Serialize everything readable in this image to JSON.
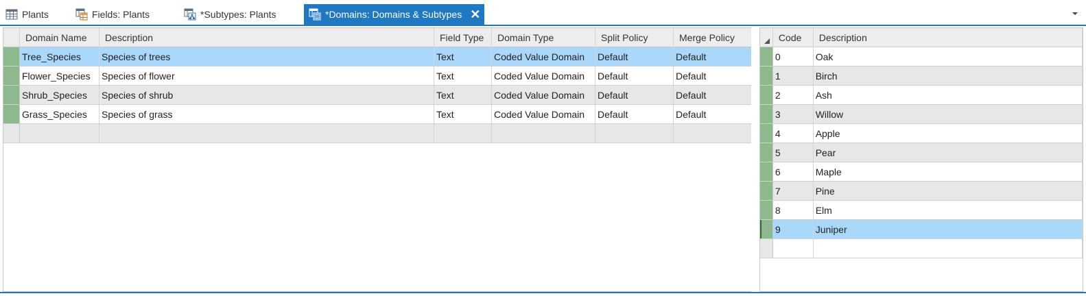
{
  "tabs": [
    {
      "label": "Plants",
      "icon": "table-icon",
      "active": false
    },
    {
      "label": "Fields:  Plants",
      "icon": "fields-view-icon",
      "active": false
    },
    {
      "label": "*Subtypes:  Plants",
      "icon": "subtypes-view-icon",
      "active": false
    },
    {
      "label": "*Domains: Domains & Subtypes",
      "icon": "domains-view-icon",
      "active": true
    }
  ],
  "colors": {
    "accent": "#1e78c2",
    "selected_row": "#a9d8fa",
    "alt_row": "#e6e7e8",
    "row_selector": "#8cba8c"
  },
  "domains_grid": {
    "headers": {
      "name": "Domain Name",
      "description": "Description",
      "field_type": "Field Type",
      "domain_type": "Domain Type",
      "split_policy": "Split Policy",
      "merge_policy": "Merge Policy"
    },
    "rows": [
      {
        "name": "Tree_Species",
        "description": "Species of trees",
        "field_type": "Text",
        "domain_type": "Coded Value Domain",
        "split_policy": "Default",
        "merge_policy": "Default"
      },
      {
        "name": "Flower_Species",
        "description": "Species of flower",
        "field_type": "Text",
        "domain_type": "Coded Value Domain",
        "split_policy": "Default",
        "merge_policy": "Default"
      },
      {
        "name": "Shrub_Species",
        "description": "Species of shrub",
        "field_type": "Text",
        "domain_type": "Coded Value Domain",
        "split_policy": "Default",
        "merge_policy": "Default"
      },
      {
        "name": "Grass_Species",
        "description": "Species of grass",
        "field_type": "Text",
        "domain_type": "Coded Value Domain",
        "split_policy": "Default",
        "merge_policy": "Default"
      }
    ]
  },
  "codes_grid": {
    "headers": {
      "code": "Code",
      "description": "Description"
    },
    "rows": [
      {
        "code": "0",
        "description": "Oak"
      },
      {
        "code": "1",
        "description": "Birch"
      },
      {
        "code": "2",
        "description": "Ash"
      },
      {
        "code": "3",
        "description": "Willow"
      },
      {
        "code": "4",
        "description": "Apple"
      },
      {
        "code": "5",
        "description": "Pear"
      },
      {
        "code": "6",
        "description": "Maple"
      },
      {
        "code": "7",
        "description": "Pine"
      },
      {
        "code": "8",
        "description": "Elm"
      },
      {
        "code": "9",
        "description": "Juniper"
      }
    ]
  }
}
